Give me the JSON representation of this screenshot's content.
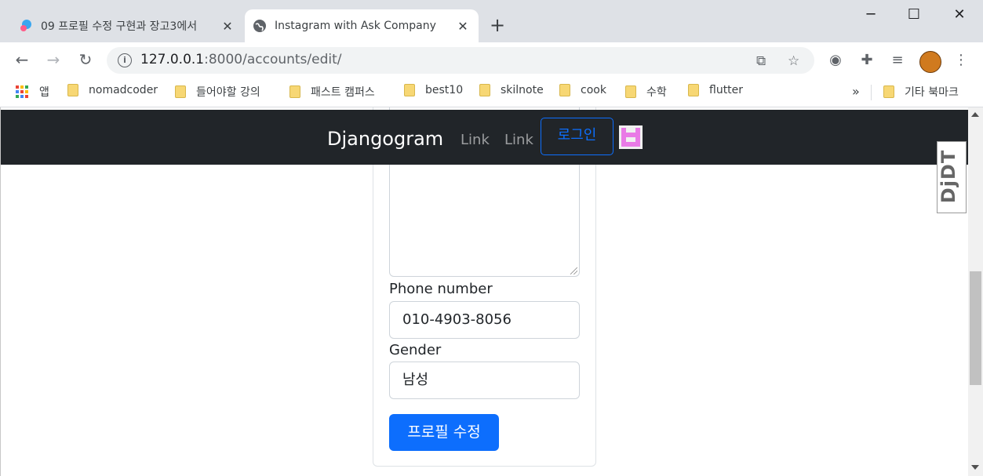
{
  "browser": {
    "tabs": [
      {
        "title": "09 프로필 수정 구현과 장고3에서",
        "active": false
      },
      {
        "title": "Instagram with Ask Company",
        "active": true
      }
    ],
    "url_host": "127.0.0.1",
    "url_path": ":8000/accounts/edit/",
    "window_controls": {
      "minimize": "─",
      "maximize": "☐",
      "close": "✕"
    },
    "nav_icons": {
      "back": "←",
      "forward": "→",
      "reload": "↻"
    },
    "bookmarks": [
      "앱",
      "nomadcoder",
      "들어야할 강의",
      "패스트 캠퍼스",
      "best10",
      "skilnote",
      "cook",
      "수학",
      "flutter"
    ],
    "bookmarks_overflow": "»",
    "other_bookmarks": "기타 북마크"
  },
  "page": {
    "navbar": {
      "brand": "Djangogram",
      "links": [
        "Link",
        "Link"
      ],
      "login_button": "로그인"
    },
    "form": {
      "phone_label": "Phone number",
      "phone_value": "010-4903-8056",
      "gender_label": "Gender",
      "gender_value": "남성",
      "submit_label": "프로필 수정"
    },
    "debug_toolbar_handle": "DjDT"
  },
  "colors": {
    "navbar_bg": "#212529",
    "primary": "#0d6efd",
    "tabstrip_bg": "#dee1e6"
  }
}
